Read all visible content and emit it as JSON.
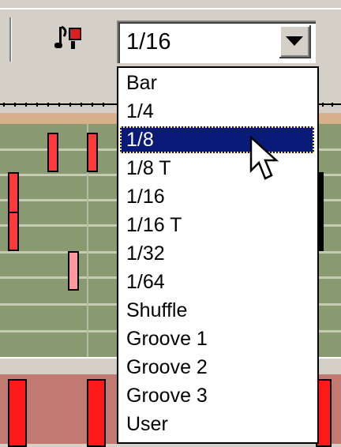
{
  "toolbar": {
    "quantize_icon": "quantize-note-icon",
    "combo_value": "1/16",
    "dropdown_icon": "chevron-down-icon"
  },
  "dropdown": {
    "selected_index": 2,
    "options": [
      {
        "label": "Bar"
      },
      {
        "label": "1/4"
      },
      {
        "label": "1/8"
      },
      {
        "label": "1/8 T"
      },
      {
        "label": "1/16"
      },
      {
        "label": "1/16 T"
      },
      {
        "label": "1/32"
      },
      {
        "label": "1/64"
      },
      {
        "label": "Shuffle"
      },
      {
        "label": "Groove 1"
      },
      {
        "label": "Groove 2"
      },
      {
        "label": "Groove 3"
      },
      {
        "label": "User"
      }
    ]
  },
  "colors": {
    "selection_bg": "#0a1a78",
    "note_fill": "#ff3a3a",
    "grid_bg": "#8a9a70"
  }
}
